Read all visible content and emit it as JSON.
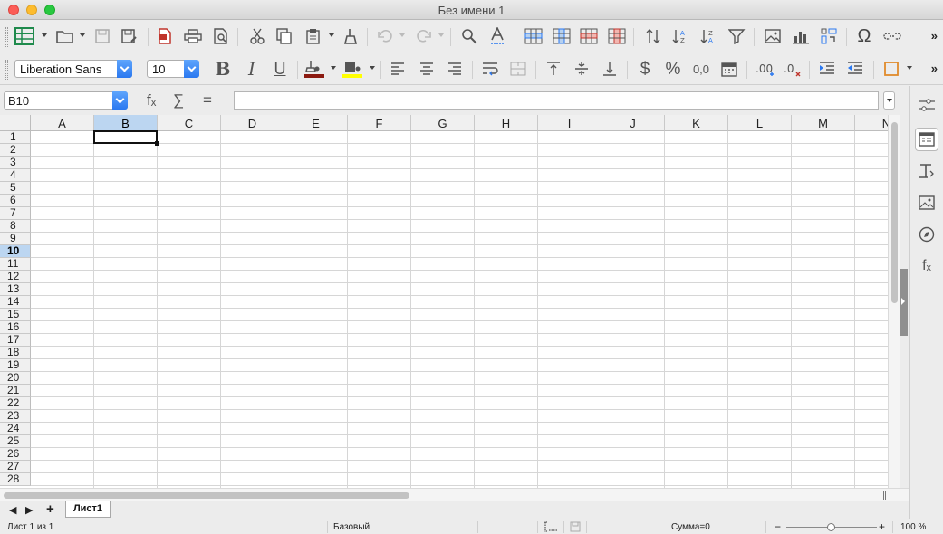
{
  "window": {
    "title": "Без имени 1"
  },
  "formatting": {
    "font_name": "Liberation Sans",
    "font_size": "10"
  },
  "formula_bar": {
    "cell_reference": "B10",
    "function_symbol": "fₓ",
    "sum_symbol": "∑",
    "equals_symbol": "=",
    "formula_value": ""
  },
  "grid": {
    "columns": [
      "A",
      "B",
      "C",
      "D",
      "E",
      "F",
      "G",
      "H",
      "I",
      "J",
      "K",
      "L",
      "M",
      "N"
    ],
    "rows": [
      "1",
      "2",
      "3",
      "4",
      "5",
      "6",
      "7",
      "8",
      "9",
      "10",
      "11",
      "12",
      "13",
      "14",
      "15",
      "16",
      "17",
      "18",
      "19",
      "20",
      "21",
      "22",
      "23",
      "24",
      "25",
      "26",
      "27",
      "28"
    ],
    "selected_column": "B",
    "selected_row": "10"
  },
  "sheets": {
    "tabs": [
      "Лист1"
    ],
    "active_tab": "Лист1"
  },
  "status_bar": {
    "sheet_position": "Лист 1 из 1",
    "page_style": "Базовый",
    "sum": "Сумма=0",
    "zoom": "100 %"
  },
  "colors": {
    "font_color": "#8b1a10",
    "highlight_color": "#ffff00",
    "selection_header": "#bcd6f1",
    "accent": "#2a78f0"
  },
  "icons": {
    "toolbar1": [
      "spreadsheet-icon",
      "open-icon",
      "save-icon",
      "save-as-icon",
      "export-pdf-icon",
      "print-icon",
      "print-preview-icon",
      "cut-icon",
      "copy-icon",
      "paste-icon",
      "clone-formatting-icon",
      "undo-icon",
      "redo-icon",
      "find-replace-icon",
      "spelling-icon",
      "row-icon",
      "column-icon",
      "insert-row-icon",
      "insert-column-icon",
      "sort-icon",
      "sort-ascending-icon",
      "sort-descending-icon",
      "autofilter-icon",
      "insert-image-icon",
      "insert-chart-icon",
      "pivot-table-icon",
      "special-character-icon",
      "hyperlink-icon"
    ],
    "sidebar": [
      "properties-icon",
      "styles-icon",
      "gallery-icon",
      "navigator-icon",
      "functions-icon"
    ]
  }
}
